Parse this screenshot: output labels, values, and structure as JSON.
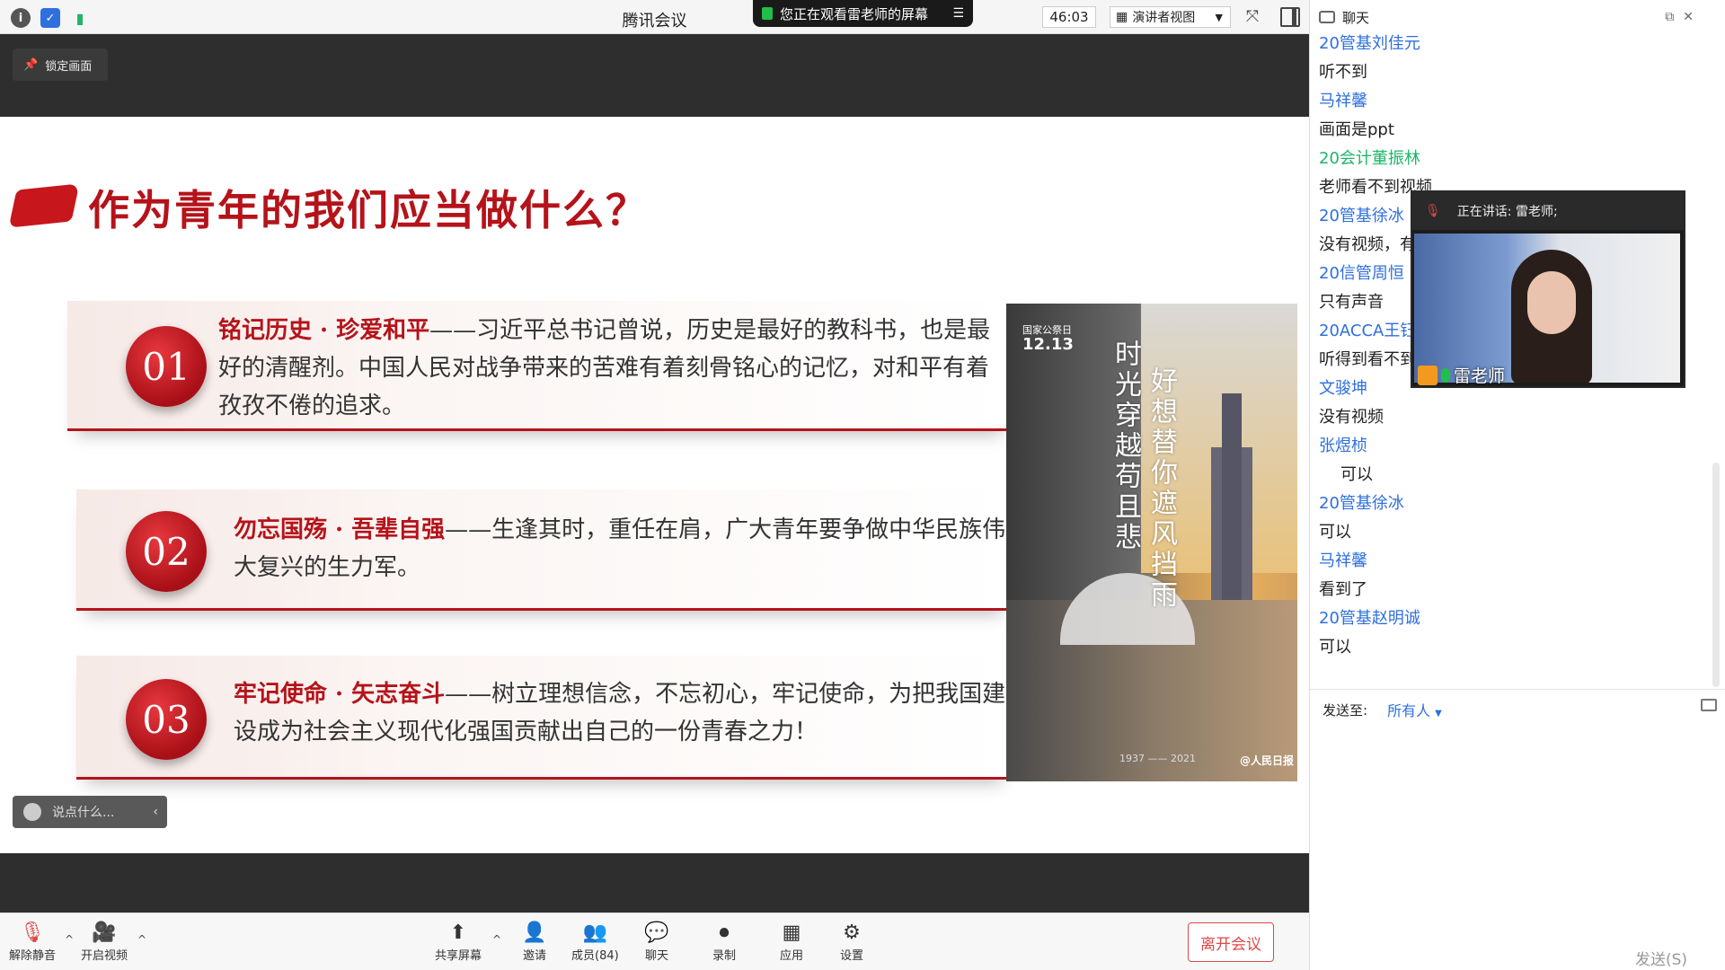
{
  "titlebar": {
    "app_title": "腾讯会议",
    "share_banner": "您正在观看雷老师的屏幕",
    "timer": "46:03",
    "view_mode": "演讲者视图"
  },
  "stage": {
    "lock_label": "锁定画面",
    "chat_placeholder": "说点什么..."
  },
  "slide": {
    "title": "作为青年的我们应当做什么？",
    "items": [
      {
        "num": "01",
        "heading": "铭记历史 · 珍爱和平",
        "body": "——习近平总书记曾说，历史是最好的教科书，也是最好的清醒剂。中国人民对战争带来的苦难有着刻骨铭心的记忆，对和平有着孜孜不倦的追求。"
      },
      {
        "num": "02",
        "heading": "勿忘国殇 · 吾辈自强",
        "body": "——生逢其时，重任在肩，广大青年要争做中华民族伟大复兴的生力军。"
      },
      {
        "num": "03",
        "heading": "牢记使命 · 矢志奋斗",
        "body": "——树立理想信念，不忘初心，牢记使命，为把我国建设成为社会主义现代化强国贡献出自己的一份青春之力！"
      }
    ],
    "poster": {
      "date_label": "国家公祭日",
      "date": "12.13",
      "line1": "时光穿越苟且悲",
      "line2": "好想替你遮风挡雨",
      "years": "1937 —— 2021",
      "logo": "@人民日报"
    }
  },
  "toolbar": {
    "unmute": "解除静音",
    "video": "开启视频",
    "share": "共享屏幕",
    "invite": "邀请",
    "members": "成员(84)",
    "chat": "聊天",
    "record": "录制",
    "apps": "应用",
    "settings": "设置",
    "leave": "离开会议"
  },
  "chat": {
    "title": "聊天",
    "messages": [
      {
        "type": "name",
        "text": "20管基刘佳元"
      },
      {
        "type": "text",
        "text": "听不到"
      },
      {
        "type": "name",
        "text": "马祥馨"
      },
      {
        "type": "text",
        "text": "画面是ppt"
      },
      {
        "type": "name-green",
        "text": "20会计董振林"
      },
      {
        "type": "text",
        "text": "老师看不到视频"
      },
      {
        "type": "name",
        "text": "20管基徐冰"
      },
      {
        "type": "text",
        "text": "没有视频，有"
      },
      {
        "type": "name",
        "text": "20信管周恒"
      },
      {
        "type": "text",
        "text": "只有声音"
      },
      {
        "type": "name",
        "text": "20ACCA王钰"
      },
      {
        "type": "text",
        "text": "听得到看不到"
      },
      {
        "type": "name",
        "text": "文骏坤"
      },
      {
        "type": "text",
        "text": "没有视频"
      },
      {
        "type": "name",
        "text": "张煜桢"
      },
      {
        "type": "text-indent",
        "text": "可以"
      },
      {
        "type": "name",
        "text": "20管基徐冰"
      },
      {
        "type": "text",
        "text": "可以"
      },
      {
        "type": "name",
        "text": "马祥馨"
      },
      {
        "type": "text",
        "text": "看到了"
      },
      {
        "type": "name",
        "text": "20管基赵明诚"
      },
      {
        "type": "text",
        "text": "可以"
      }
    ],
    "send_to_label": "发送至:",
    "send_to_value": "所有人",
    "send_button": "发送(S)"
  },
  "video": {
    "speaking": "正在讲话: 雷老师;",
    "name": "雷老师"
  }
}
